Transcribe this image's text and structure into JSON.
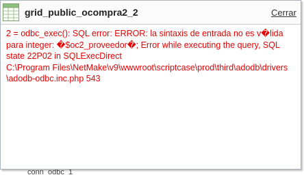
{
  "popup": {
    "title": "grid_public_ocompra2_2",
    "close_label": "Cerrar",
    "icon": "grid-table-icon",
    "error_lines": [
      "2 = odbc_exec(): SQL error: ERROR: la sintaxis de entrada no es v�lida",
      "para integer: �$oc2_proveedor�; Error while executing the query, SQL",
      "state 22P02 in SQLExecDirect",
      "C:\\Program Files\\NetMake\\v9\\wwwroot\\scriptcase\\prod\\third\\adodb\\drivers",
      "\\adodb-odbc.inc.php 543"
    ],
    "error_color": "#e60000"
  },
  "background": {
    "partial_text": "conn_odbc_1"
  }
}
